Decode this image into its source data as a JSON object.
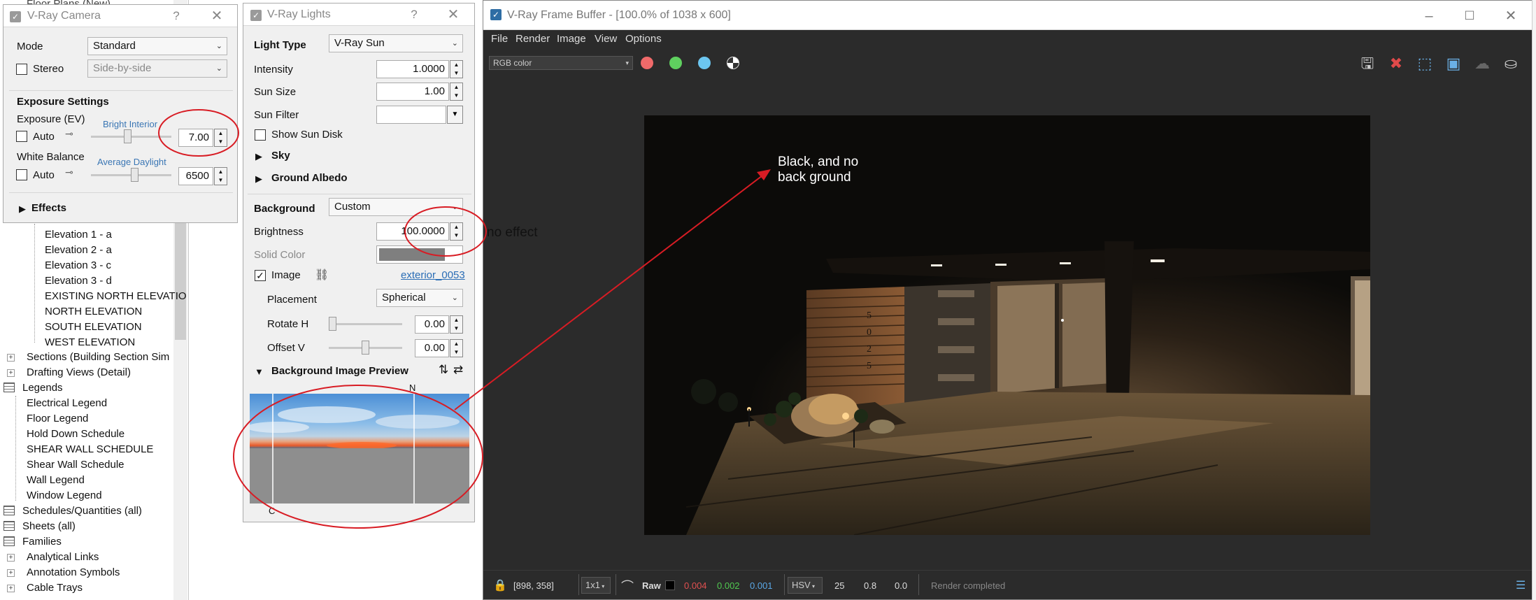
{
  "browser": {
    "top_partial": "Floor Plans (New)",
    "elevations": [
      "Elevation 1 - a",
      "Elevation 2 - a",
      "Elevation 3 - c",
      "Elevation 3 - d",
      "EXISTING NORTH ELEVATIO",
      "NORTH ELEVATION",
      "SOUTH ELEVATION",
      "WEST ELEVATION"
    ],
    "sections": "Sections (Building Section Sim",
    "drafting": "Drafting Views (Detail)",
    "legends": "Legends",
    "legend_items": [
      "Electrical Legend",
      "Floor Legend",
      "Hold Down Schedule",
      "SHEAR WALL SCHEDULE",
      "Shear Wall Schedule",
      "Wall Legend",
      "Window Legend"
    ],
    "schedules": "Schedules/Quantities (all)",
    "sheets": "Sheets (all)",
    "families": "Families",
    "family_items": [
      "Analytical Links",
      "Annotation Symbols",
      "Cable Trays"
    ]
  },
  "camera": {
    "title": "V-Ray Camera",
    "help": "?",
    "close": "✕",
    "mode_label": "Mode",
    "mode_value": "Standard",
    "stereo_label": "Stereo",
    "stereo_value": "Side-by-side",
    "exposure_header": "Exposure Settings",
    "exposure_label": "Exposure (EV)",
    "exposure_preset": "Bright Interior",
    "auto_label": "Auto",
    "exposure_value": "7.00",
    "exposure_slider_level": 0.45,
    "wb_label": "White Balance",
    "wb_preset": "Average Daylight",
    "wb_value": "6500",
    "wb_slider_level": 0.55,
    "effects_label": "Effects"
  },
  "lights": {
    "title": "V-Ray Lights",
    "help": "?",
    "close": "✕",
    "light_type_label": "Light Type",
    "light_type_value": "V-Ray Sun",
    "intensity_label": "Intensity",
    "intensity_value": "1.0000",
    "sun_size_label": "Sun Size",
    "sun_size_value": "1.00",
    "sun_filter_label": "Sun Filter",
    "show_sun_disk_label": "Show Sun Disk",
    "sky_label": "Sky",
    "ground_albedo_label": "Ground Albedo",
    "background_label": "Background",
    "background_value": "Custom",
    "brightness_label": "Brightness",
    "brightness_value": "100.0000",
    "solid_color_label": "Solid Color",
    "image_label": "Image",
    "image_link": "exterior_0053",
    "placement_label": "Placement",
    "placement_value": "Spherical",
    "rotate_h_label": "Rotate H",
    "rotate_h_value": "0.00",
    "rotate_h_level": 0.0,
    "offset_v_label": "Offset V",
    "offset_v_value": "0.00",
    "offset_v_level": 0.5,
    "preview_label": "Background Image Preview",
    "preview_n": "N",
    "preview_c": "C"
  },
  "vfb": {
    "title": "V-Ray Frame Buffer - [100.0% of 1038 x 600]",
    "menu": [
      "File",
      "Render",
      "Image",
      "View",
      "Options"
    ],
    "channel": "RGB color",
    "status": {
      "coords": "[898, 358]",
      "zoom": "1x1",
      "raw": "Raw",
      "r": "0.004",
      "g": "0.002",
      "b": "0.001",
      "mode": "HSV",
      "h": "25",
      "s": "0.8",
      "v": "0.0",
      "message": "Render completed"
    },
    "house_number": [
      "5",
      "0",
      "2",
      "5"
    ]
  },
  "annotations": {
    "no_effect": "no effect",
    "black_note_1": "Black, and no",
    "black_note_2": "back ground"
  },
  "colors": {
    "annotation_red": "#d81c24",
    "link_blue": "#2a6db5",
    "preset_blue": "#3a76b4",
    "red_dot": "#f06a6a",
    "green_dot": "#5fd05f",
    "blue_dot": "#6cc6f0"
  }
}
